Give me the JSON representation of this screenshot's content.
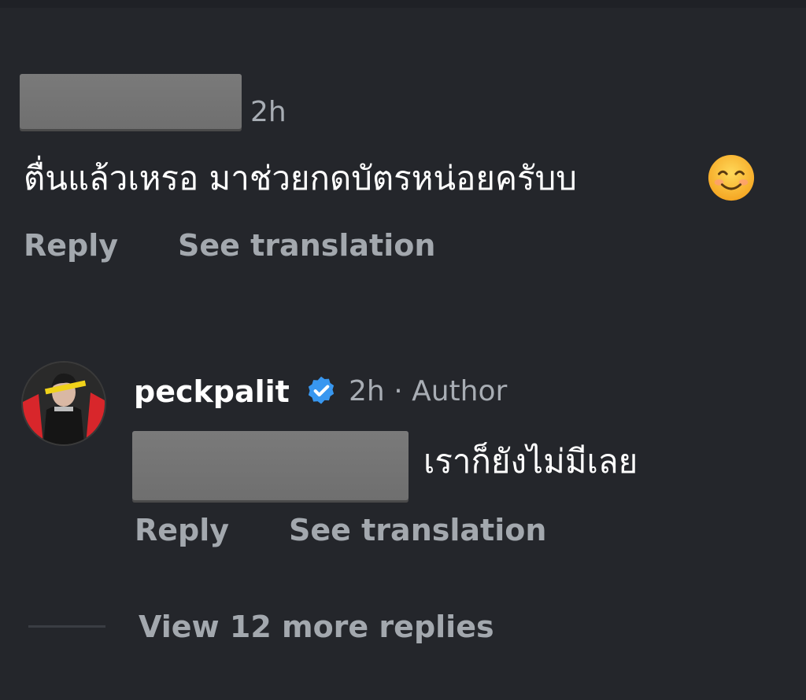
{
  "comment1": {
    "time": "2h",
    "text": "ตื่นแล้วเหรอ  มาช่วยกดบัตรหน่อยครับบ",
    "emoji": "smiling-face-emoji",
    "reply_label": "Reply",
    "translate_label": "See translation"
  },
  "reply1": {
    "username": "peckpalit",
    "verified_icon": "verified-badge-icon",
    "time": "2h",
    "separator": "·",
    "role": "Author",
    "text": "เราก็ยังไม่มีเลย",
    "reply_label": "Reply",
    "translate_label": "See translation"
  },
  "more_replies": {
    "label": "View 12 more replies"
  },
  "colors": {
    "background": "#24262b",
    "text": "#ffffff",
    "muted": "#a8adb4",
    "verified": "#3897f0"
  }
}
